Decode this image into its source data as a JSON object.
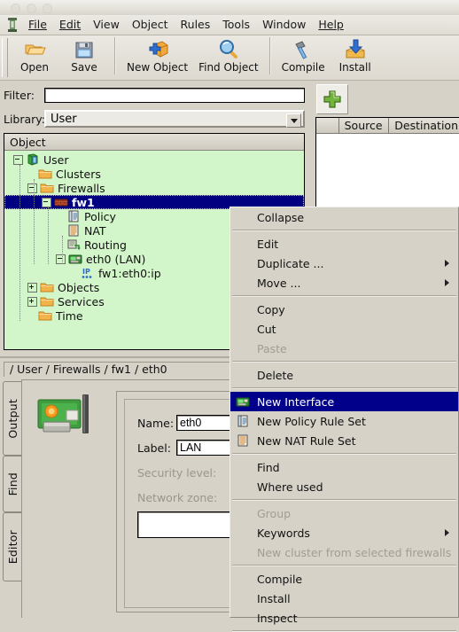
{
  "window": {
    "buttons": [
      "close",
      "minimize",
      "maximize"
    ]
  },
  "menubar": {
    "app_icon": "tower-icon",
    "items": [
      {
        "label": "File",
        "mnemonic": "F"
      },
      {
        "label": "Edit",
        "mnemonic": "E"
      },
      {
        "label": "View",
        "mnemonic": ""
      },
      {
        "label": "Object",
        "mnemonic": ""
      },
      {
        "label": "Rules",
        "mnemonic": ""
      },
      {
        "label": "Tools",
        "mnemonic": ""
      },
      {
        "label": "Window",
        "mnemonic": ""
      },
      {
        "label": "Help",
        "mnemonic": "H"
      }
    ]
  },
  "toolbar": {
    "buttons": [
      {
        "label": "Open",
        "icon": "open-folder-icon"
      },
      {
        "label": "Save",
        "icon": "floppy-disk-icon"
      },
      {
        "label": "New Object",
        "icon": "new-object-icon"
      },
      {
        "label": "Find Object",
        "icon": "magnifier-icon"
      },
      {
        "label": "Compile",
        "icon": "hammer-icon"
      },
      {
        "label": "Install",
        "icon": "install-download-icon"
      }
    ]
  },
  "filter": {
    "label": "Filter:",
    "value": "",
    "placeholder": ""
  },
  "library": {
    "label": "Library:",
    "value": "User",
    "options": [
      "User"
    ]
  },
  "tree": {
    "header": "Object",
    "nodes": [
      {
        "label": "User",
        "indent": 0,
        "icon": "library-cube-icon",
        "expander": "minus",
        "selected": false
      },
      {
        "label": "Clusters",
        "indent": 1,
        "icon": "folder-icon",
        "expander": "none",
        "selected": false
      },
      {
        "label": "Firewalls",
        "indent": 1,
        "icon": "folder-icon",
        "expander": "minus",
        "selected": false
      },
      {
        "label": "fw1",
        "indent": 2,
        "icon": "firewall-icon",
        "expander": "minus",
        "selected": true
      },
      {
        "label": "Policy",
        "indent": 3,
        "icon": "policy-icon",
        "expander": "none",
        "selected": false
      },
      {
        "label": "NAT",
        "indent": 3,
        "icon": "nat-icon",
        "expander": "none",
        "selected": false
      },
      {
        "label": "Routing",
        "indent": 3,
        "icon": "routing-icon",
        "expander": "none",
        "selected": false
      },
      {
        "label": "eth0 (LAN)",
        "indent": 3,
        "icon": "interface-icon",
        "expander": "minus",
        "selected": false
      },
      {
        "label": "fw1:eth0:ip",
        "indent": 4,
        "icon": "ip-address-icon",
        "expander": "none",
        "selected": false
      },
      {
        "label": "Objects",
        "indent": 1,
        "icon": "folder-icon",
        "expander": "plus",
        "selected": false
      },
      {
        "label": "Services",
        "indent": 1,
        "icon": "folder-icon",
        "expander": "plus",
        "selected": false
      },
      {
        "label": "Time",
        "indent": 1,
        "icon": "folder-icon",
        "expander": "none",
        "selected": false
      }
    ]
  },
  "rules_panel": {
    "add_button_icon": "green-plus-icon",
    "columns": [
      "",
      "Source",
      "Destination"
    ],
    "rows": []
  },
  "breadcrumb": {
    "path": "/ User / Firewalls / fw1 / eth0"
  },
  "side_tabs": [
    {
      "label": "Output"
    },
    {
      "label": "Find"
    },
    {
      "label": "Editor"
    }
  ],
  "editor": {
    "object_icon": "network-card-icon",
    "fields": [
      {
        "label": "Name:",
        "value": "eth0",
        "disabled": false
      },
      {
        "label": "Label:",
        "value": "LAN",
        "disabled": false
      },
      {
        "label": "Security level:",
        "value": "",
        "disabled": true
      },
      {
        "label": "Network zone:",
        "value": "",
        "disabled": true
      }
    ],
    "comment_value": ""
  },
  "context_menu": {
    "items": [
      {
        "label": "Collapse",
        "icon": "",
        "disabled": false,
        "highlighted": false,
        "submenu": false
      },
      {
        "type": "separator"
      },
      {
        "label": "Edit",
        "icon": "",
        "disabled": false,
        "highlighted": false,
        "submenu": false
      },
      {
        "label": "Duplicate ...",
        "icon": "",
        "disabled": false,
        "highlighted": false,
        "submenu": true
      },
      {
        "label": "Move ...",
        "icon": "",
        "disabled": false,
        "highlighted": false,
        "submenu": true
      },
      {
        "type": "separator"
      },
      {
        "label": "Copy",
        "icon": "",
        "disabled": false,
        "highlighted": false,
        "submenu": false
      },
      {
        "label": "Cut",
        "icon": "",
        "disabled": false,
        "highlighted": false,
        "submenu": false
      },
      {
        "label": "Paste",
        "icon": "",
        "disabled": true,
        "highlighted": false,
        "submenu": false
      },
      {
        "type": "separator"
      },
      {
        "label": "Delete",
        "icon": "",
        "disabled": false,
        "highlighted": false,
        "submenu": false
      },
      {
        "type": "separator"
      },
      {
        "label": "New Interface",
        "icon": "interface-icon",
        "disabled": false,
        "highlighted": true,
        "submenu": false
      },
      {
        "label": "New Policy Rule Set",
        "icon": "policy-icon",
        "disabled": false,
        "highlighted": false,
        "submenu": false
      },
      {
        "label": "New NAT Rule Set",
        "icon": "nat-icon",
        "disabled": false,
        "highlighted": false,
        "submenu": false
      },
      {
        "type": "separator"
      },
      {
        "label": "Find",
        "icon": "",
        "disabled": false,
        "highlighted": false,
        "submenu": false
      },
      {
        "label": "Where used",
        "icon": "",
        "disabled": false,
        "highlighted": false,
        "submenu": false
      },
      {
        "type": "separator"
      },
      {
        "label": "Group",
        "icon": "",
        "disabled": true,
        "highlighted": false,
        "submenu": false
      },
      {
        "label": "Keywords",
        "icon": "",
        "disabled": false,
        "highlighted": false,
        "submenu": true
      },
      {
        "label": "New cluster from selected firewalls",
        "icon": "",
        "disabled": true,
        "highlighted": false,
        "submenu": false
      },
      {
        "type": "separator"
      },
      {
        "label": "Compile",
        "icon": "",
        "disabled": false,
        "highlighted": false,
        "submenu": false
      },
      {
        "label": "Install",
        "icon": "",
        "disabled": false,
        "highlighted": false,
        "submenu": false
      },
      {
        "label": "Inspect",
        "icon": "",
        "disabled": false,
        "highlighted": false,
        "submenu": false
      },
      {
        "type": "separator"
      }
    ]
  },
  "colors": {
    "tree_background": "#d2f5c9",
    "selection": "#000080",
    "menu_highlight": "#00008b",
    "chrome": "#d6d2c8",
    "disabled_text": "#a19d94"
  }
}
